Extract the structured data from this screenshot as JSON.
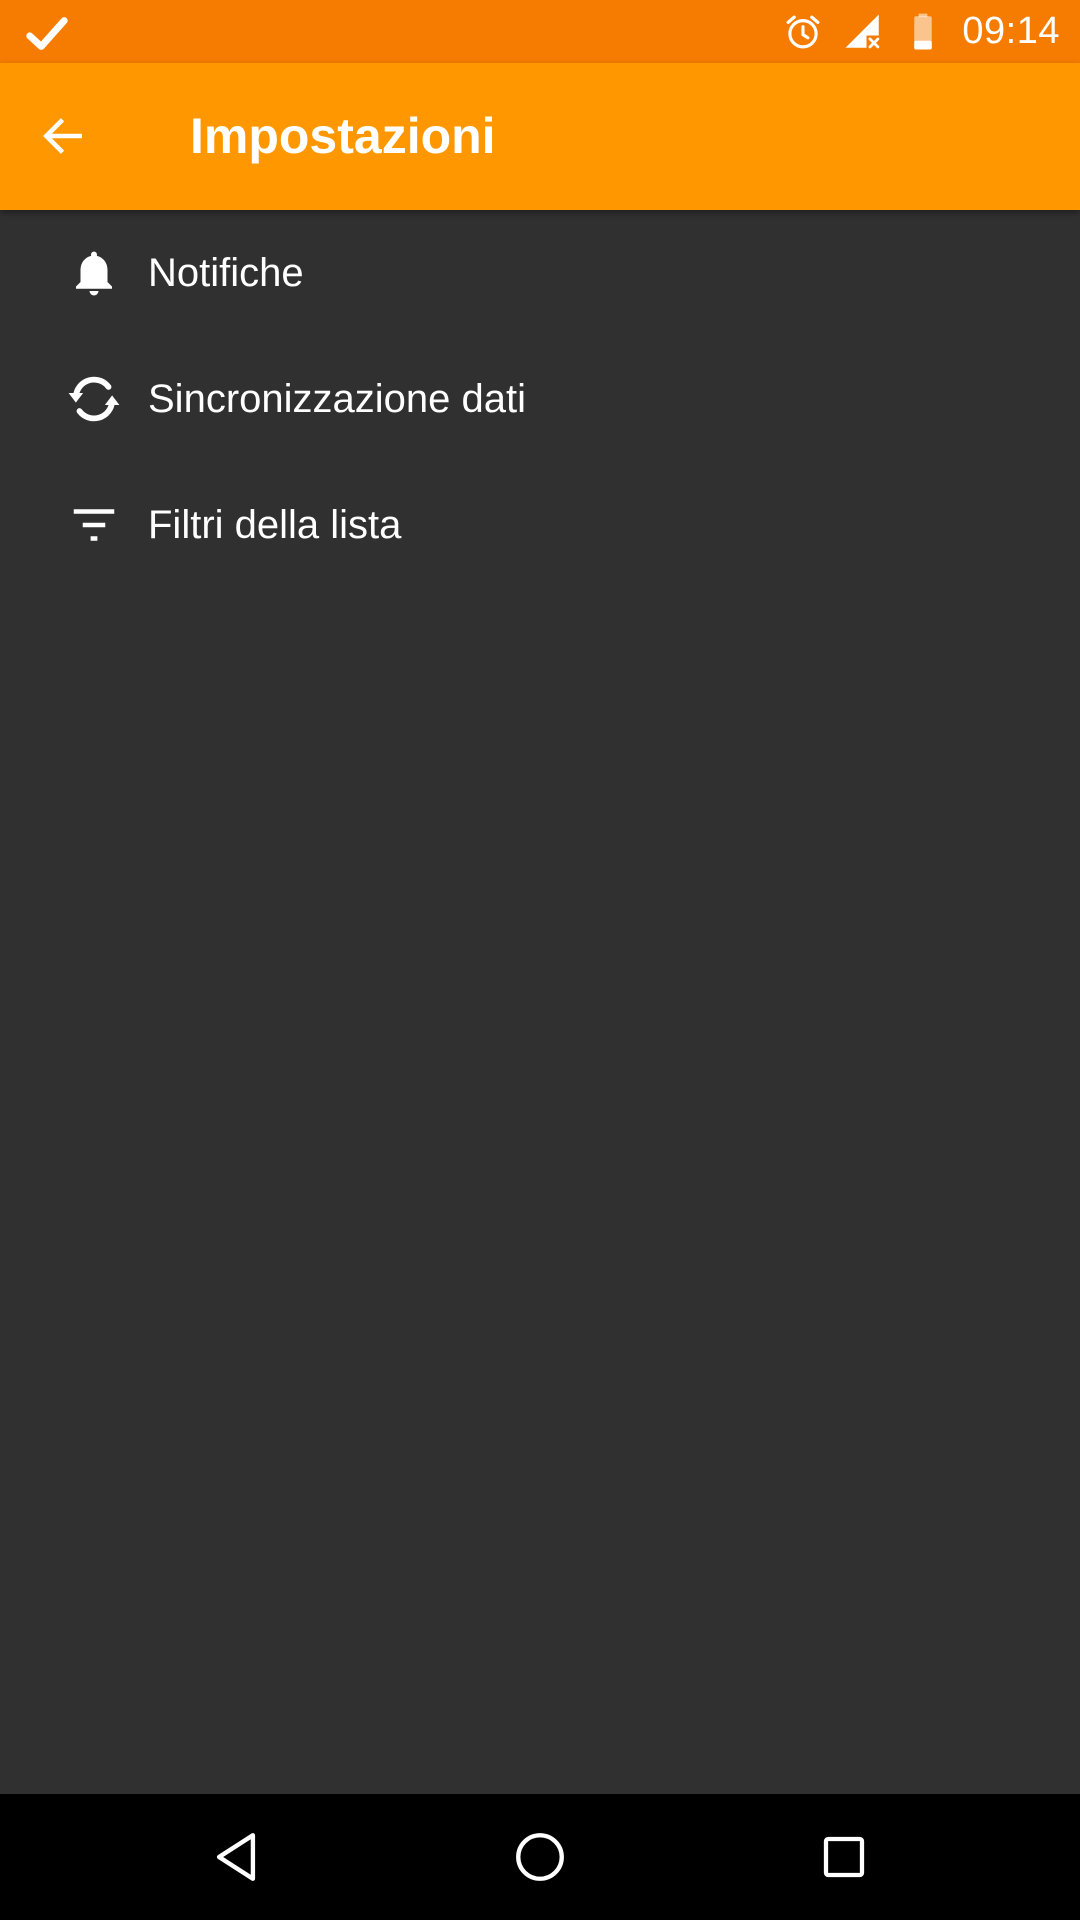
{
  "status_bar": {
    "time": "09:14",
    "left_icon": "check-icon",
    "icons": [
      "alarm-icon",
      "signal-off-icon",
      "battery-low-icon"
    ]
  },
  "app_bar": {
    "title": "Impostazioni",
    "back_icon": "arrow-back-icon"
  },
  "menu": {
    "items": [
      {
        "label": "Notifiche",
        "icon": "bell-icon"
      },
      {
        "label": "Sincronizzazione dati",
        "icon": "sync-icon"
      },
      {
        "label": "Filtri della lista",
        "icon": "filter-icon"
      }
    ]
  },
  "nav_bar": {
    "buttons": [
      "back-triangle-icon",
      "home-circle-icon",
      "recents-square-icon"
    ]
  },
  "colors": {
    "status_bar": "#F57C00",
    "app_bar": "#FF9800",
    "background": "#303030",
    "nav_bar": "#000000",
    "text": "#FFFFFF"
  }
}
